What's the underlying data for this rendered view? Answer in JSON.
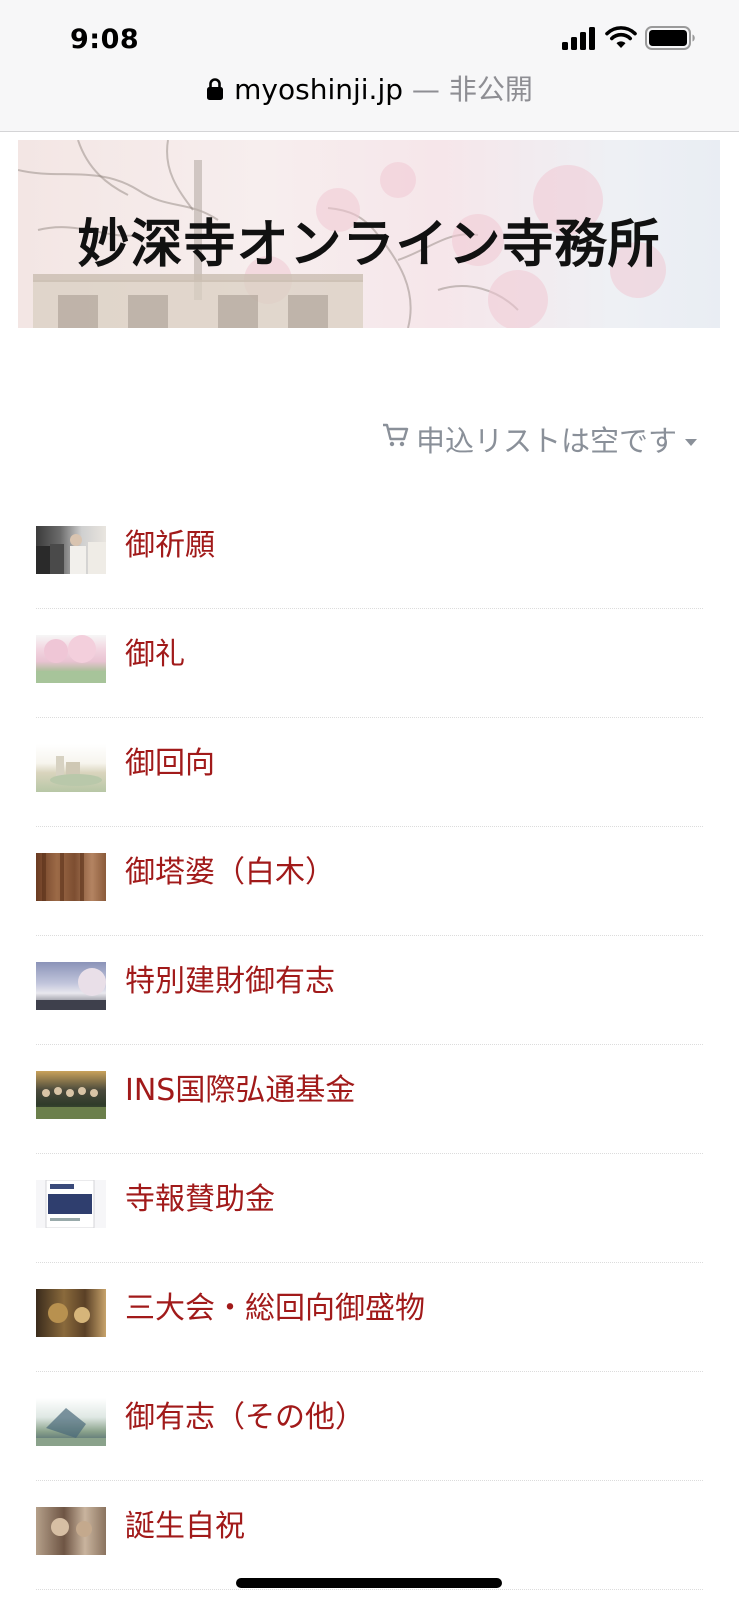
{
  "status_bar": {
    "time": "9:08"
  },
  "address_bar": {
    "domain": "myoshinji.jp",
    "separator": " — ",
    "privacy": "非公開"
  },
  "banner": {
    "title": "妙深寺オンライン寺務所"
  },
  "cart": {
    "text": "申込リストは空です"
  },
  "products": [
    {
      "label": "御祈願"
    },
    {
      "label": "御礼"
    },
    {
      "label": "御回向"
    },
    {
      "label": "御塔婆（白木）"
    },
    {
      "label": "特別建財御有志"
    },
    {
      "label": "INS国際弘通基金"
    },
    {
      "label": "寺報賛助金"
    },
    {
      "label": "三大会・総回向御盛物"
    },
    {
      "label": "御有志（その他）"
    },
    {
      "label": "誕生自祝"
    }
  ],
  "colors": {
    "link": "#a11a1a",
    "muted": "#8a9099",
    "chrome": "#f7f7f8"
  }
}
